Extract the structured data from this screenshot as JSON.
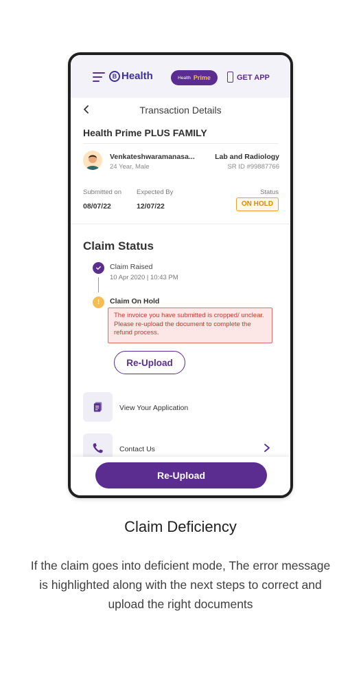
{
  "appbar": {
    "logo_text": "Health",
    "logo_letter": "B",
    "prime_health": "Health",
    "prime_label": "Prime",
    "get_app": "GET APP"
  },
  "nav": {
    "title": "Transaction Details"
  },
  "plan": {
    "name": "Health Prime PLUS FAMILY"
  },
  "patient": {
    "name": "Venkateshwaramanasa...",
    "meta": "24 Year, Male",
    "service": "Lab and Radiology",
    "sr_id": "SR ID #99887766"
  },
  "dates": {
    "submitted_label": "Submitted on",
    "submitted_value": "08/07/22",
    "expected_label": "Expected By",
    "expected_value": "12/07/22",
    "status_label": "Status",
    "status_value": "ON HOLD"
  },
  "claim": {
    "heading": "Claim Status",
    "steps": [
      {
        "title": "Claim Raised",
        "time": "10 Apr 2020 | 10:43 PM"
      },
      {
        "title": "Claim On Hold"
      }
    ],
    "error_message": "The invoice you have submitted is cropped/ unclear. Please re-upload the document to complete the refund process.",
    "reupload_label": "Re-Upload"
  },
  "actions": [
    {
      "label": "View Your Application",
      "icon": "document-icon"
    },
    {
      "label": "Contact Us",
      "icon": "phone-icon"
    }
  ],
  "footer": {
    "primary_label": "Re-Upload"
  },
  "caption": {
    "title": "Claim Deficiency",
    "text": "If the claim goes into deficient mode, The error message is highlighted along with the next steps to correct and upload the right documents"
  },
  "colors": {
    "brand_purple": "#5b2d91",
    "warning_orange": "#e08a00",
    "error_red": "#c33a2d"
  }
}
